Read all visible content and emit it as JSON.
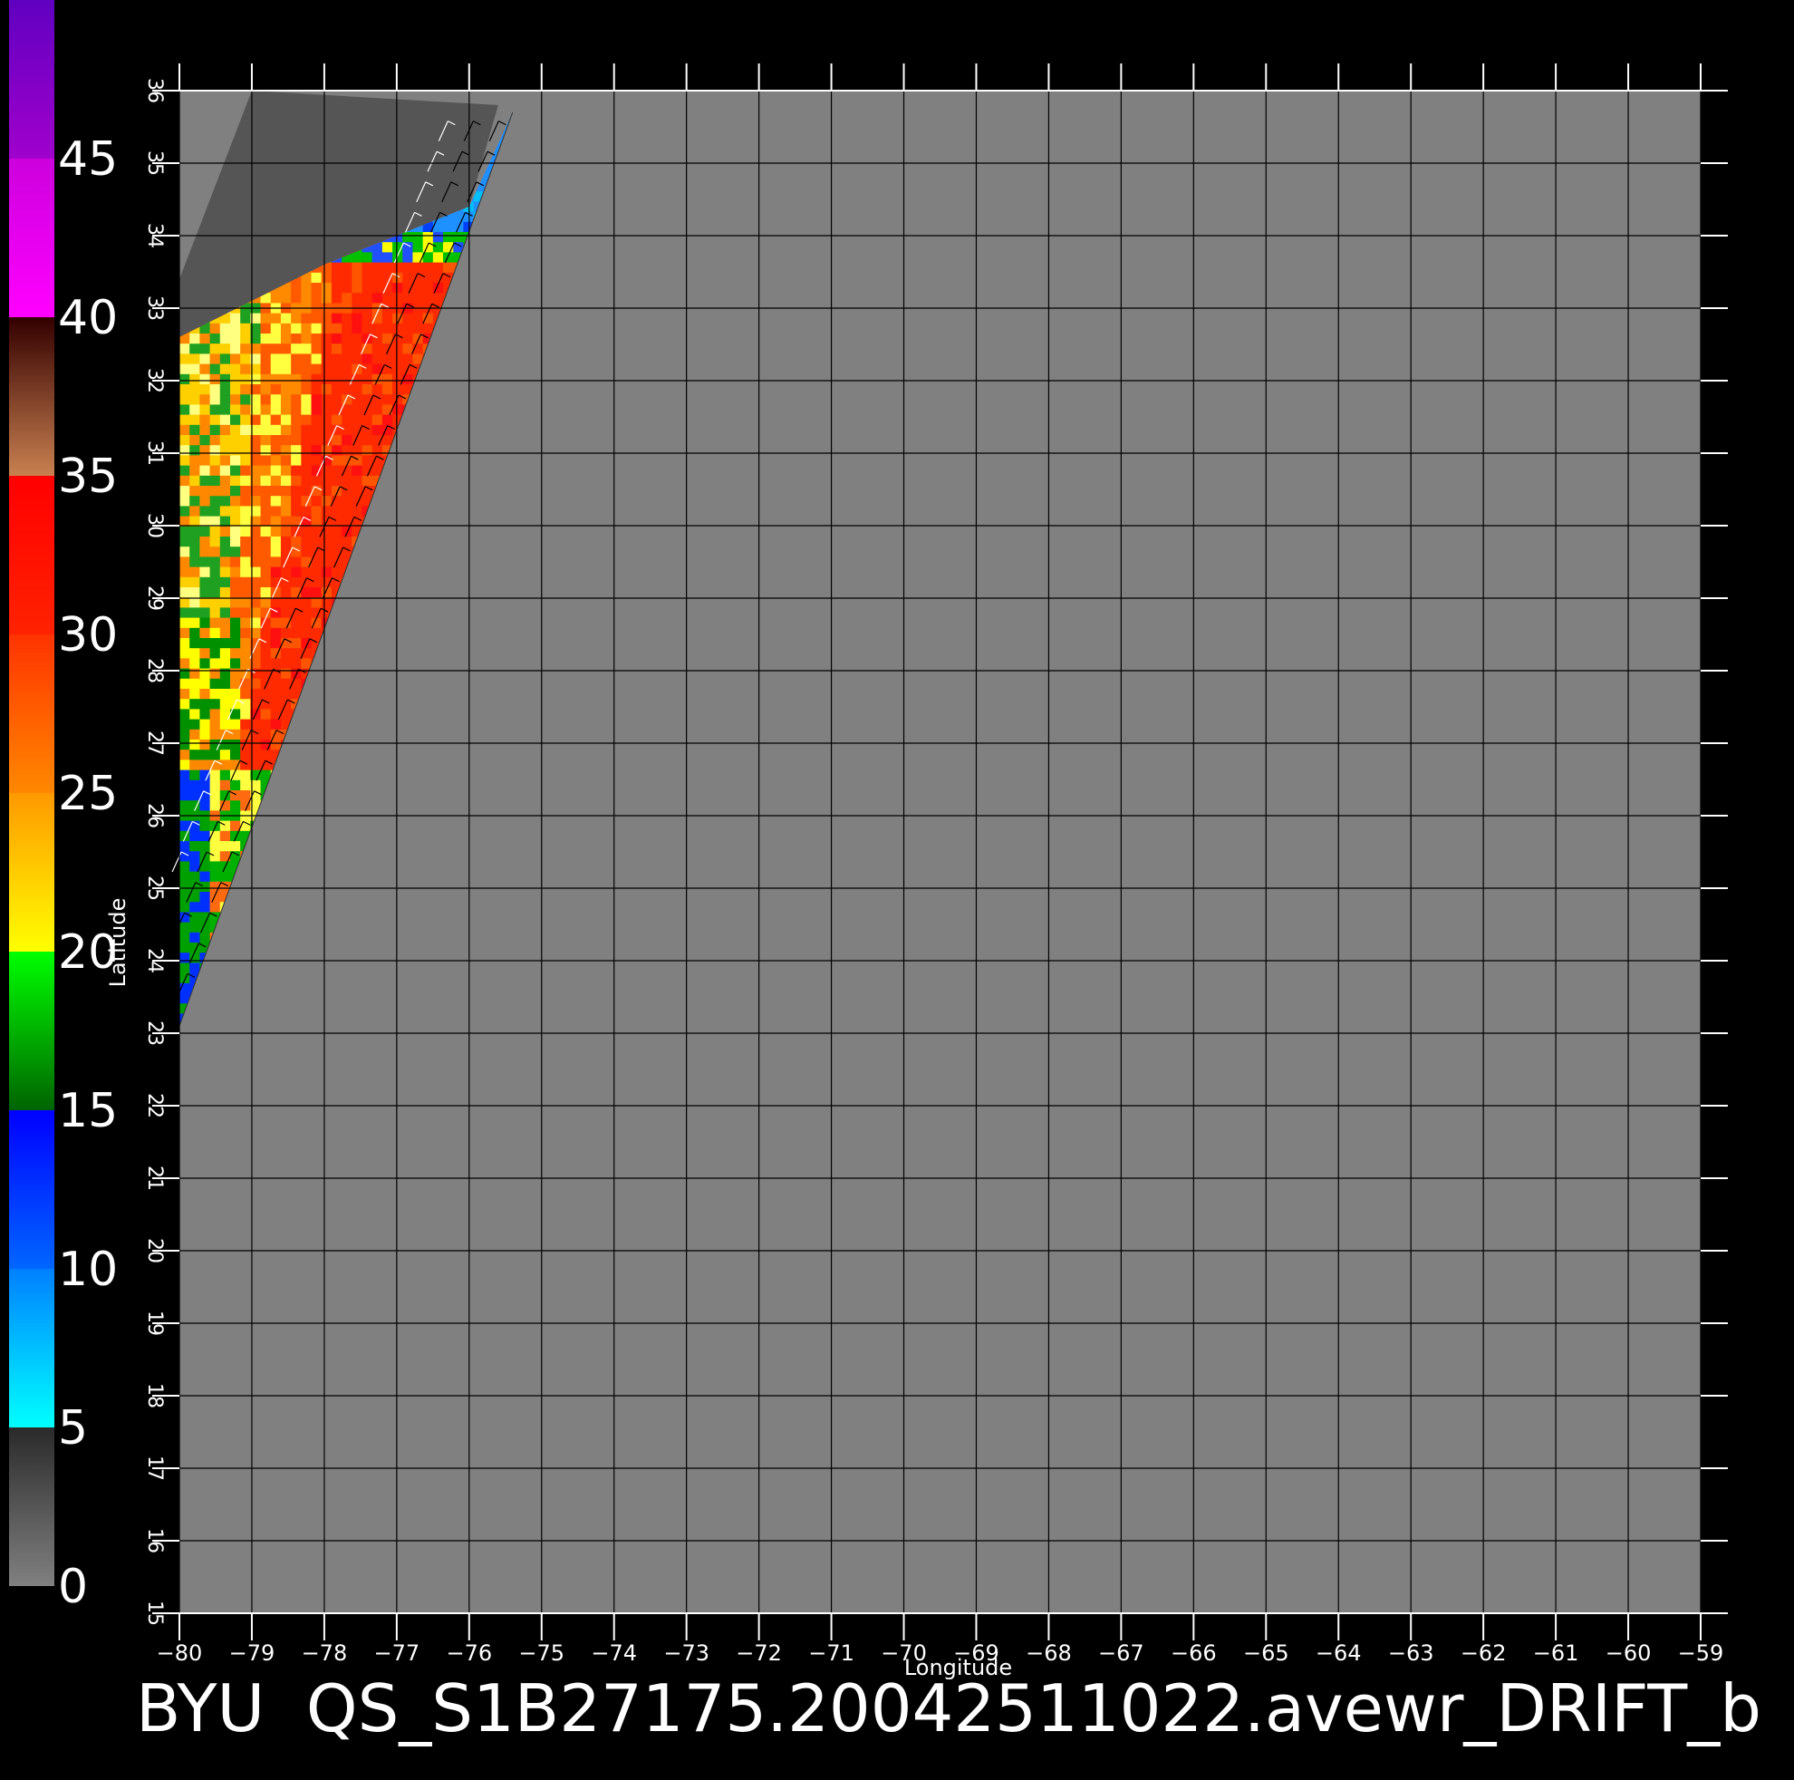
{
  "title": "BYU  QS_S1B27175.20042511022.avewr_DRIFT_b",
  "colorbar": {
    "labels": [
      "0",
      "5",
      "10",
      "15",
      "20",
      "25",
      "30",
      "35",
      "40",
      "45"
    ],
    "segments": [
      {
        "from": 0,
        "to": 5,
        "colors": [
          "#808080",
          "#2a2a2a"
        ]
      },
      {
        "from": 5,
        "to": 10,
        "colors": [
          "#00ffff",
          "#0080ff"
        ]
      },
      {
        "from": 10,
        "to": 15,
        "colors": [
          "#0066ff",
          "#0000ff"
        ]
      },
      {
        "from": 15,
        "to": 20,
        "colors": [
          "#006400",
          "#00ff00"
        ]
      },
      {
        "from": 20,
        "to": 25,
        "colors": [
          "#ffff00",
          "#ff9900"
        ]
      },
      {
        "from": 25,
        "to": 30,
        "colors": [
          "#ff8800",
          "#ff3300"
        ]
      },
      {
        "from": 30,
        "to": 35,
        "colors": [
          "#ff2200",
          "#ff0000"
        ]
      },
      {
        "from": 35,
        "to": 40,
        "colors": [
          "#c88050",
          "#330000"
        ]
      },
      {
        "from": 40,
        "to": 45,
        "colors": [
          "#ff00ff",
          "#cc00dd"
        ]
      },
      {
        "from": 45,
        "to": 50,
        "colors": [
          "#a000cc",
          "#6000c0"
        ]
      }
    ]
  },
  "axes": {
    "xlabel": "Longitude",
    "ylabel": "Latitude",
    "xlim": [
      -80,
      -59
    ],
    "ylim": [
      15,
      36
    ],
    "xticks": [
      "-80",
      "-79",
      "-78",
      "-77",
      "-76",
      "-75",
      "-74",
      "-73",
      "-72",
      "-71",
      "-70",
      "-69",
      "-68",
      "-67",
      "-66",
      "-65",
      "-64",
      "-63",
      "-62",
      "-61",
      "-60",
      "-59"
    ],
    "yticks": [
      "15",
      "16",
      "17",
      "18",
      "19",
      "20",
      "21",
      "22",
      "23",
      "24",
      "25",
      "26",
      "27",
      "28",
      "29",
      "30",
      "31",
      "32",
      "33",
      "34",
      "35",
      "36"
    ]
  },
  "colors": {
    "background": "#000000",
    "land_nodata": "#808080",
    "swath_nodata": "#555555",
    "grid": "#000000",
    "text": "#ffffff"
  },
  "swath": {
    "outer_edge": [
      [
        -79.0,
        36.0
      ],
      [
        -80.0,
        33.4
      ]
    ],
    "inner_edge": [
      [
        -75.4,
        35.7
      ],
      [
        -80.0,
        23.1
      ]
    ],
    "land_edge": [
      [
        -75.6,
        35.8
      ],
      [
        -76.0,
        34.4
      ],
      [
        -78.0,
        33.6
      ],
      [
        -80.0,
        32.6
      ]
    ]
  }
}
